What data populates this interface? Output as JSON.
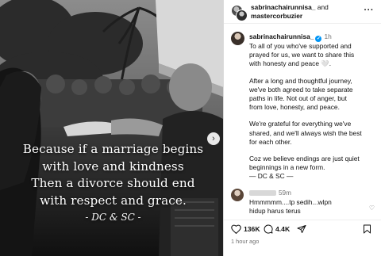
{
  "post": {
    "photo": {
      "quote_lines": [
        "Because if a marriage begins",
        "with love and kindness",
        "Then a divorce should end",
        "with respect and grace."
      ],
      "quote_signature": "- DC & SC -",
      "next_icon": "chevron-right-icon"
    },
    "header": {
      "owner_1": "sabrinachairunnisa_",
      "joiner": " and",
      "owner_2": "mastercorbuzier",
      "more_icon": "more-horizontal-icon",
      "more_label": "···"
    },
    "caption": {
      "username": "sabrinachairunnisa_",
      "time": "1h",
      "paragraphs": [
        [
          "To all of you who've supported and",
          "prayed for us, we want to share this",
          "with honesty and peace 🤍."
        ],
        [
          "After a long and thoughtful journey,",
          "we've both agreed to take separate",
          "paths in life. Not out of anger, but",
          "from love, honesty, and peace."
        ],
        [
          "We're grateful for everything we've",
          "shared, and we'll always wish the best",
          "for each other."
        ],
        [
          "Coz we believe endings are just quiet",
          "beginnings in a new form.",
          "— DC & SC —"
        ]
      ]
    },
    "comment": {
      "time": "59m",
      "lines": [
        "Hmmmmm....tp sedih...wlpn",
        "hidup harus terus"
      ]
    },
    "actions": {
      "likes": "136K",
      "comments": "4.4K",
      "like_icon": "heart-icon",
      "comment_icon": "comment-icon",
      "share_icon": "send-icon",
      "save_icon": "bookmark-icon"
    },
    "time_ago": "1 hour ago"
  },
  "colors": {
    "verified": "#0095f6",
    "muted_text": "#737373",
    "border": "#dbdbdb"
  }
}
